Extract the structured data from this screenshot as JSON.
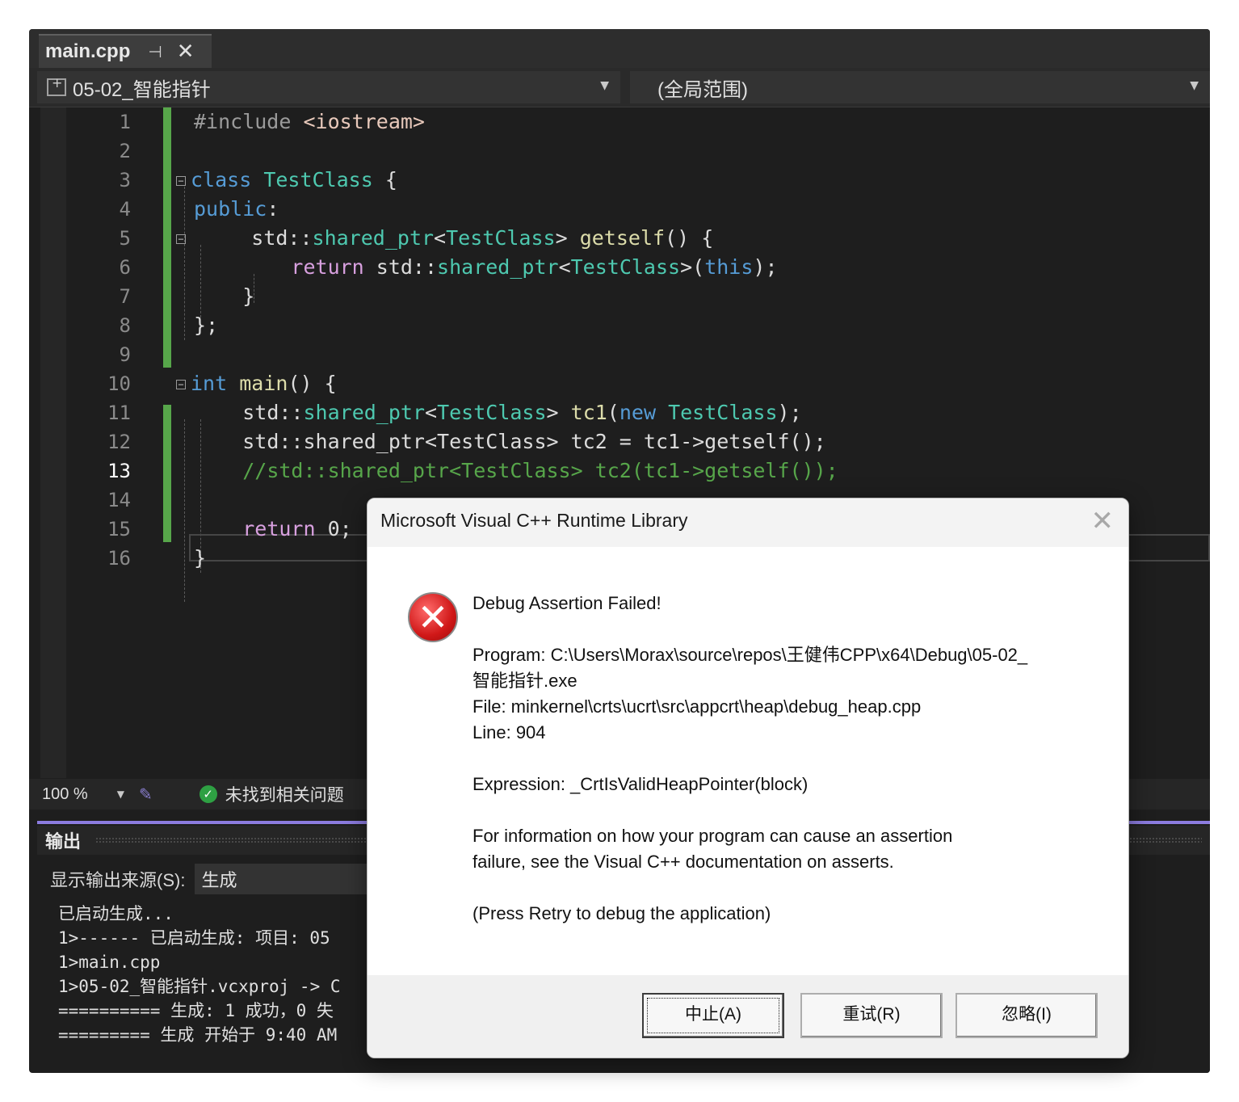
{
  "tab": {
    "title": "main.cpp",
    "pin_icon": "pin-icon",
    "close_icon": "close-icon"
  },
  "navbar": {
    "project": "05-02_智能指针",
    "scope": "(全局范围)"
  },
  "editor": {
    "line_numbers": [
      "1",
      "2",
      "3",
      "4",
      "5",
      "6",
      "7",
      "8",
      "9",
      "10",
      "11",
      "12",
      "13",
      "14",
      "15",
      "16"
    ],
    "current_line": "13",
    "lines": {
      "l1_a": "#include ",
      "l1_b": "<iostream>",
      "l3_a": "class ",
      "l3_b": "TestClass",
      "l3_c": " {",
      "l4_a": "public",
      "l4_b": ":",
      "l5_a": "std::",
      "l5_b": "shared_ptr",
      "l5_c": "<",
      "l5_d": "TestClass",
      "l5_e": "> ",
      "l5_f": "getself",
      "l5_g": "() {",
      "l6_a": "return ",
      "l6_b": "std::",
      "l6_c": "shared_ptr",
      "l6_d": "<",
      "l6_e": "TestClass",
      "l6_f": ">(",
      "l6_g": "this",
      "l6_h": ");",
      "l7": "}",
      "l8": "};",
      "l10_a": "int ",
      "l10_b": "main",
      "l10_c": "() {",
      "l11_a": "std::",
      "l11_b": "shared_ptr",
      "l11_c": "<",
      "l11_d": "TestClass",
      "l11_e": "> ",
      "l11_f": "tc1",
      "l11_g": "(",
      "l11_h": "new ",
      "l11_i": "TestClass",
      "l11_j": ");",
      "l12": "std::shared_ptr<TestClass> tc2 = tc1->getself();",
      "l13": "//std::shared_ptr<TestClass> tc2(tc1->getself());",
      "l15_a": "return ",
      "l15_b": "0;",
      "l16": "}"
    }
  },
  "status": {
    "zoom": "100 %",
    "issues": "未找到相关问题"
  },
  "output": {
    "title": "输出",
    "source_label": "显示输出来源(S):",
    "source_value": "生成",
    "lines": [
      "已启动生成...",
      "1>------ 已启动生成: 项目: 05",
      "1>main.cpp",
      "1>05-02_智能指针.vcxproj -> C",
      "========== 生成: 1 成功，0 失",
      "========= 生成 开始于 9:40 AM"
    ]
  },
  "dialog": {
    "title": "Microsoft Visual C++ Runtime Library",
    "heading": "Debug Assertion Failed!",
    "program_1": "Program: C:\\Users\\Morax\\source\\repos\\王健伟CPP\\x64\\Debug\\05-02_",
    "program_2": "智能指针.exe",
    "file": "File: minkernel\\crts\\ucrt\\src\\appcrt\\heap\\debug_heap.cpp",
    "line": "Line: 904",
    "expression": "Expression: _CrtIsValidHeapPointer(block)",
    "info_1": "For information on how your program can cause an assertion",
    "info_2": "failure, see the Visual C++ documentation on asserts.",
    "retry_hint": "(Press Retry to debug the application)",
    "buttons": {
      "abort": "中止(A)",
      "retry": "重试(R)",
      "ignore": "忽略(I)"
    }
  },
  "colors": {
    "keyword": "#569cd6",
    "type": "#4ec9b0",
    "control": "#d8a0df",
    "function": "#dcdcaa",
    "comment": "#57a64a",
    "accent": "#8c7ce0"
  }
}
